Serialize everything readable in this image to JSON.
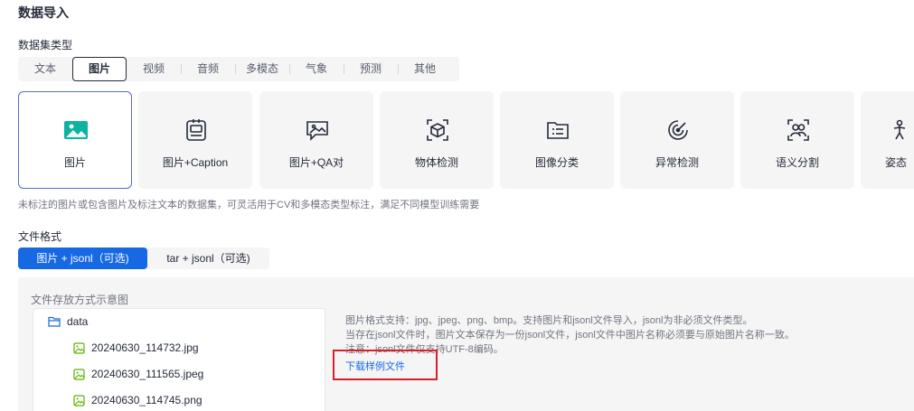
{
  "page": {
    "title": "数据导入"
  },
  "dataset": {
    "label": "数据集类型",
    "tabs": [
      {
        "label": "文本",
        "active": false
      },
      {
        "label": "图片",
        "active": true
      },
      {
        "label": "视频",
        "active": false
      },
      {
        "label": "音频",
        "active": false
      },
      {
        "label": "多模态",
        "active": false
      },
      {
        "label": "气象",
        "active": false
      },
      {
        "label": "预测",
        "active": false
      },
      {
        "label": "其他",
        "active": false
      }
    ],
    "cards": [
      {
        "label": "图片",
        "icon": "image-icon",
        "selected": true
      },
      {
        "label": "图片+Caption",
        "icon": "caption-icon",
        "selected": false
      },
      {
        "label": "图片+QA对",
        "icon": "qa-icon",
        "selected": false
      },
      {
        "label": "物体检测",
        "icon": "cube-icon",
        "selected": false
      },
      {
        "label": "图像分类",
        "icon": "folder-list-icon",
        "selected": false
      },
      {
        "label": "异常检测",
        "icon": "target-icon",
        "selected": false
      },
      {
        "label": "语义分割",
        "icon": "people-icon",
        "selected": false
      },
      {
        "label": "姿态",
        "icon": "pose-icon",
        "selected": false
      }
    ],
    "description": "未标注的图片或包含图片及标注文本的数据集，可灵活用于CV和多模态类型标注，满足不同模型训练需要"
  },
  "format": {
    "label": "文件格式",
    "options": [
      {
        "label": "图片 + jsonl（可选)",
        "active": true
      },
      {
        "label": "tar + jsonl（可选)",
        "active": false
      }
    ]
  },
  "preview": {
    "title": "文件存放方式示意图",
    "folder": "data",
    "files": [
      "20240630_114732.jpg",
      "20240630_111565.jpeg",
      "20240630_114745.png"
    ],
    "info_lines": [
      "图片格式支持：jpg、jpeg、png、bmp。支持图片和jsonl文件导入，jsonl为非必须文件类型。",
      "当存在jsonl文件时，图片文本保存为一份jsonl文件，jsonl文件中图片名称必须要与原始图片名称一致。",
      "注意：jsonl文件仅支持UTF-8编码。"
    ],
    "download_label": "下载样例文件"
  },
  "colors": {
    "primary": "#1668e3",
    "accent_icon": "#0fb2a0",
    "file_icon": "#5cb300",
    "folder_icon": "#1668e3",
    "highlight": "#d9202a"
  }
}
